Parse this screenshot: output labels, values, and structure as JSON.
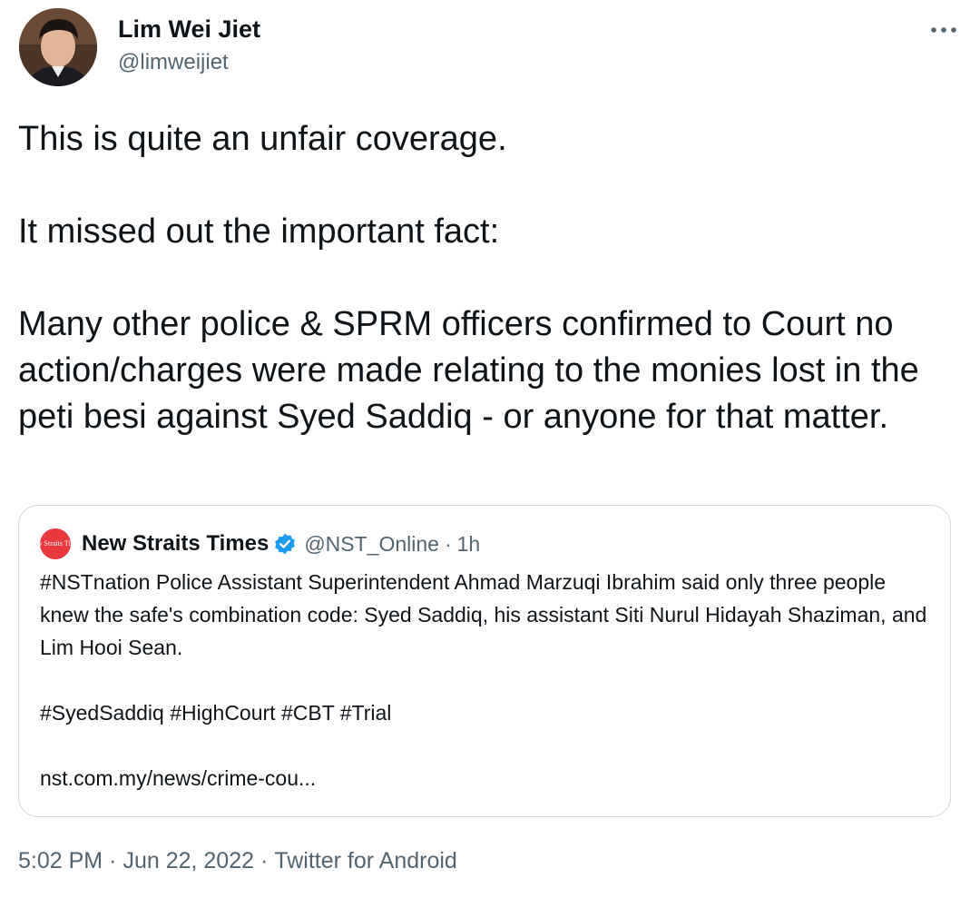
{
  "author": {
    "name": "Lim Wei Jiet",
    "handle": "@limweijiet"
  },
  "tweet": {
    "paragraphs": [
      "This is quite an unfair coverage.",
      "It missed out the important fact:",
      "Many other police & SPRM officers confirmed to Court no action/charges were made relating to the monies lost in the peti besi against Syed Saddiq - or anyone for that matter."
    ]
  },
  "quoted_tweet": {
    "name": "New Straits Times",
    "handle": "@NST_Online",
    "separator": "·",
    "time": "1h",
    "avatar_text": "New Straits Times",
    "body": "#NSTnation Police Assistant Superintendent Ahmad Marzuqi Ibrahim said only three people knew the safe's combination code: Syed Saddiq, his assistant Siti Nurul Hidayah Shaziman, and Lim Hooi Sean.",
    "hashtags": "#SyedSaddiq #HighCourt #CBT #Trial",
    "link": "nst.com.my/news/crime-cou..."
  },
  "meta": {
    "time": "5:02 PM",
    "date": "Jun 22, 2022",
    "source": "Twitter for Android",
    "separator": "·"
  },
  "icons": {
    "more": "more-horizontal-icon",
    "verified": "verified-badge-icon"
  },
  "colors": {
    "text": "#0f1419",
    "secondary": "#536471",
    "verified": "#1d9bf0",
    "border": "#cfd9de",
    "nst_brand": "#e8383d"
  }
}
